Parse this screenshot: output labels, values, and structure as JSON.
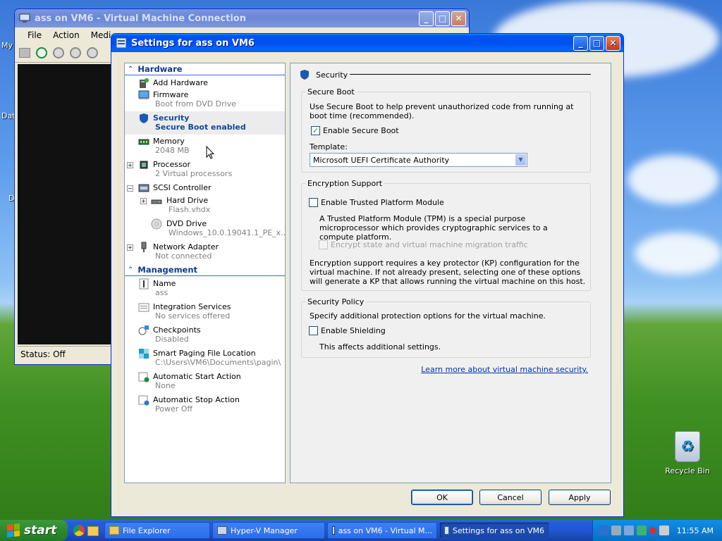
{
  "desktop": {
    "icons": [
      {
        "label": "My"
      },
      {
        "label": "Dat"
      },
      {
        "label": "D"
      },
      {
        "label": "Recycle Bin"
      }
    ]
  },
  "vm_window": {
    "title": "ass on VM6 - Virtual Machine Connection",
    "menu": [
      "File",
      "Action",
      "Medi"
    ],
    "status": "Status: Off"
  },
  "dialog": {
    "title": "Settings for ass on VM6",
    "tree": {
      "hardware_header": "Hardware",
      "hardware_items": [
        {
          "name": "Add Hardware",
          "detail": ""
        },
        {
          "name": "Firmware",
          "detail": "Boot from DVD Drive"
        },
        {
          "name": "Security",
          "detail": "Secure Boot enabled",
          "selected": true
        },
        {
          "name": "Memory",
          "detail": "2048 MB"
        },
        {
          "name": "Processor",
          "detail": "2 Virtual processors"
        },
        {
          "name": "SCSI Controller",
          "detail": ""
        },
        {
          "name": "Hard Drive",
          "detail": "Flash.vhdx"
        },
        {
          "name": "DVD Drive",
          "detail": "Windows_10.0.19041.1_PE_x..."
        },
        {
          "name": "Network Adapter",
          "detail": "Not connected"
        }
      ],
      "management_header": "Management",
      "management_items": [
        {
          "name": "Name",
          "detail": "ass"
        },
        {
          "name": "Integration Services",
          "detail": "No services offered"
        },
        {
          "name": "Checkpoints",
          "detail": "Disabled"
        },
        {
          "name": "Smart Paging File Location",
          "detail": "C:\\Users\\VM6\\Documents\\pagin\\"
        },
        {
          "name": "Automatic Start Action",
          "detail": "None"
        },
        {
          "name": "Automatic Stop Action",
          "detail": "Power Off"
        }
      ]
    },
    "security": {
      "header": "Security",
      "secure_boot": {
        "legend": "Secure Boot",
        "desc": "Use Secure Boot to help prevent unauthorized code from running at boot time (recommended).",
        "enable_label": "Enable Secure Boot",
        "enable_checked": true,
        "template_label": "Template:",
        "template_value": "Microsoft UEFI Certificate Authority"
      },
      "encryption": {
        "legend": "Encryption Support",
        "tpm_label": "Enable Trusted Platform Module",
        "tpm_checked": false,
        "tpm_desc": "A Trusted Platform Module (TPM) is a special purpose microprocessor which provides cryptographic services to a compute platform.",
        "encrypt_label": "Encrypt state and virtual machine migration traffic",
        "note": "Encryption support requires a key protector (KP) configuration for the virtual machine. If not already present, selecting one of these options will generate a KP that allows running the virtual machine on this host."
      },
      "policy": {
        "legend": "Security Policy",
        "desc": "Specify additional protection options for the virtual machine.",
        "shielding_label": "Enable Shielding",
        "shielding_checked": false,
        "shielding_note": "This affects additional settings."
      },
      "learn_more": "Learn more about virtual machine security."
    },
    "buttons": {
      "ok": "OK",
      "cancel": "Cancel",
      "apply": "Apply"
    }
  },
  "taskbar": {
    "start_label": "start",
    "tasks": [
      {
        "label": "File Explorer"
      },
      {
        "label": "Hyper-V Manager"
      },
      {
        "label": "ass on VM6 - Virtual M..."
      },
      {
        "label": "Settings for ass on VM6"
      }
    ],
    "clock": "11:55 AM"
  }
}
